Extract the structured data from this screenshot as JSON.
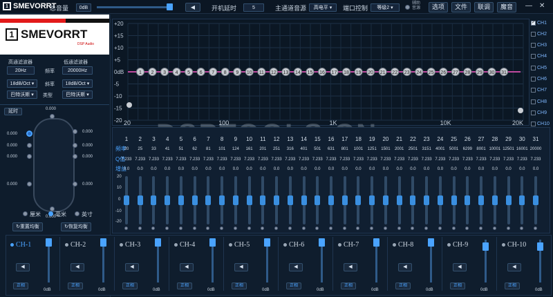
{
  "titlebar": {
    "brand": "SMEVORRT",
    "master_volume_label": "总音量",
    "master_volume_value": "0dB",
    "startup_delay_label": "开机延时",
    "startup_delay_value": "5",
    "main_source_label": "主通道音源",
    "main_source_value": "高电平",
    "port_control_label": "端口控制",
    "port_control_value": "等级2",
    "aux_source_label": "辅助音源",
    "menu": [
      "选项",
      "文件",
      "联调",
      "魔音"
    ],
    "minimize": "—",
    "close": "✕"
  },
  "logo": {
    "text": "SMEVORRT",
    "box": "1",
    "sub": "DSP Audio"
  },
  "filters": {
    "hp_label": "高通滤波器",
    "lp_label": "低通滤波器",
    "hp_freq": "20Hz",
    "freq_label": "频率",
    "lp_freq": "20000Hz",
    "hp_slope": "18dB/Oct",
    "slope_label": "斜率",
    "lp_slope": "18dB/Oct",
    "hp_type": "巴特沃斯",
    "type_label": "类型",
    "lp_type": "巴特沃斯"
  },
  "delay": {
    "title": "延时",
    "values_left": [
      "0.000",
      "0.000",
      "0.000",
      "0.000"
    ],
    "values_right": [
      "0.000",
      "0.000",
      "0.000",
      "0.000"
    ],
    "top": "0.000",
    "bottom": "0.000",
    "units": [
      "厘米",
      "毫米",
      "英寸"
    ],
    "reset": "重置均衡",
    "restore": "恢复均衡"
  },
  "graph": {
    "y_ticks": [
      "+20",
      "+15",
      "+10",
      "+5",
      "0dB",
      "-5",
      "-10",
      "-15",
      "-20"
    ],
    "x_ticks": [
      "20",
      "100",
      "1K",
      "10K",
      "20K"
    ],
    "watermark": "DSPTOOLS.CN"
  },
  "channels": [
    "CH1",
    "CH2",
    "CH3",
    "CH4",
    "CH5",
    "CH6",
    "CH7",
    "CH8",
    "CH9",
    "CH10"
  ],
  "eq": {
    "freq_label": "频率",
    "q_label": "Q值",
    "gain_label": "增益",
    "scale": [
      "20",
      "10",
      "0",
      "-10",
      "-20"
    ],
    "bands": [
      "1",
      "2",
      "3",
      "4",
      "5",
      "6",
      "7",
      "8",
      "9",
      "10",
      "11",
      "12",
      "13",
      "14",
      "15",
      "16",
      "17",
      "18",
      "19",
      "20",
      "21",
      "22",
      "23",
      "24",
      "25",
      "26",
      "27",
      "28",
      "29",
      "30",
      "31"
    ],
    "freqs": [
      "20",
      "25",
      "33",
      "41",
      "51",
      "62",
      "81",
      "101",
      "124",
      "161",
      "201",
      "251",
      "316",
      "401",
      "501",
      "631",
      "801",
      "1001",
      "1251",
      "1501",
      "2001",
      "2501",
      "3151",
      "4001",
      "5001",
      "6299",
      "8001",
      "10001",
      "12501",
      "16001",
      "20000"
    ],
    "q": "7.233",
    "gain": "0.0"
  },
  "outputs": [
    {
      "name": "CH-1",
      "phase": "正相",
      "level": "0dB"
    },
    {
      "name": "CH-2",
      "phase": "正相",
      "level": "0dB"
    },
    {
      "name": "CH-3",
      "phase": "正相",
      "level": "0dB"
    },
    {
      "name": "CH-4",
      "phase": "正相",
      "level": "0dB"
    },
    {
      "name": "CH-5",
      "phase": "正相",
      "level": "0dB"
    },
    {
      "name": "CH-6",
      "phase": "正相",
      "level": "0dB"
    },
    {
      "name": "CH-7",
      "phase": "正相",
      "level": "0dB"
    },
    {
      "name": "CH-8",
      "phase": "正相",
      "level": "0dB"
    },
    {
      "name": "CH-9",
      "phase": "正相",
      "level": "0dB"
    },
    {
      "name": "CH-10",
      "phase": "正相",
      "level": "0dB"
    }
  ],
  "colors": {
    "accent": "#3a8fe0",
    "curve": "#c04aa0",
    "bg": "#0d1b2a"
  }
}
